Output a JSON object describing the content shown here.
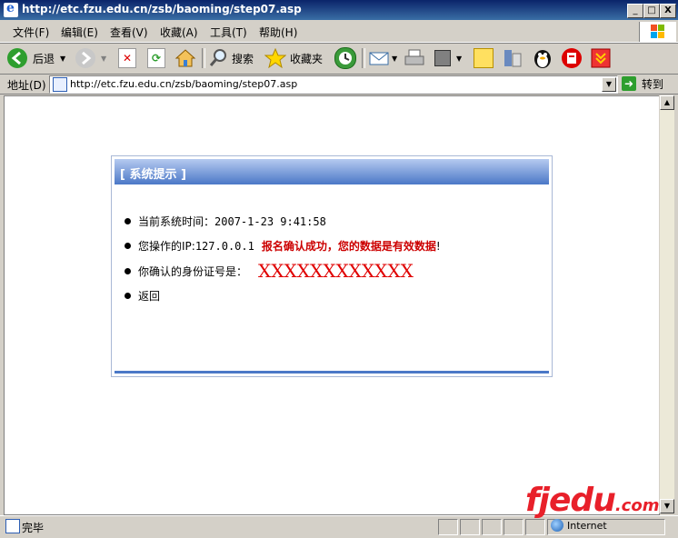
{
  "window": {
    "title": "http://etc.fzu.edu.cn/zsb/baoming/step07.asp",
    "minimize": "_",
    "maximize": "□",
    "close": "X"
  },
  "menu": [
    "文件(F)",
    "编辑(E)",
    "查看(V)",
    "收藏(A)",
    "工具(T)",
    "帮助(H)"
  ],
  "toolbar": {
    "back_label": "后退",
    "search_label": "搜索",
    "favorites_label": "收藏夹"
  },
  "address": {
    "label": "地址(D)",
    "url": "http://etc.fzu.edu.cn/zsb/baoming/step07.asp",
    "go_label": "转到"
  },
  "panel": {
    "title": "[ 系统提示 ]",
    "time_label": "当前系统时间：",
    "time_value": "2007-1-23 9:41:58",
    "ip_label": "您操作的IP:",
    "ip_value": "127.0.0.1",
    "success_msg": "报名确认成功，您的数据是有效数据",
    "success_suffix": "!",
    "id_label": "你确认的身份证号是：",
    "id_value": "XXXXXXXXXXXX",
    "back_link": "返回"
  },
  "status": {
    "text": "完毕",
    "zone": "Internet"
  },
  "watermark": {
    "main": "fjedu",
    "suffix": ".com"
  },
  "colors": {
    "title_bar": "#0a246a",
    "panel_header": "#4b78c7",
    "success_red": "#cc0000",
    "id_red": "#e00000",
    "watermark_red": "#e8202a"
  }
}
